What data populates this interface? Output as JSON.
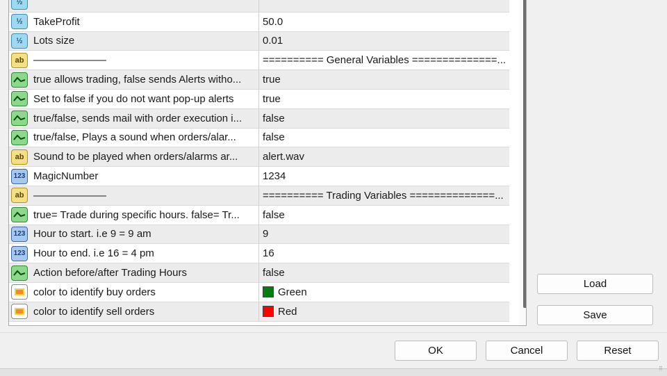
{
  "rows": [
    {
      "icon": "half-icon",
      "icon_text": "½",
      "name": "",
      "value": "",
      "alt": true
    },
    {
      "icon": "half-icon",
      "icon_text": "½",
      "name": "TakeProfit",
      "value": "50.0",
      "alt": false
    },
    {
      "icon": "half-icon",
      "icon_text": "½",
      "name": "Lots size",
      "value": "0.01",
      "alt": true
    },
    {
      "icon": "ab-icon",
      "icon_text": "ab",
      "name": "———————",
      "value": "========== General Variables ==============...",
      "alt": false
    },
    {
      "icon": "bool-icon",
      "icon_text": "",
      "name": "true allows trading, false sends Alerts witho...",
      "value": "true",
      "alt": true
    },
    {
      "icon": "bool-icon",
      "icon_text": "",
      "name": "Set to false if you do not want pop-up alerts",
      "value": "true",
      "alt": false
    },
    {
      "icon": "bool-icon",
      "icon_text": "",
      "name": "true/false, sends mail with order execution i...",
      "value": "false",
      "alt": true
    },
    {
      "icon": "bool-icon",
      "icon_text": "",
      "name": "true/false, Plays a sound when orders/alar...",
      "value": "false",
      "alt": false
    },
    {
      "icon": "ab-icon",
      "icon_text": "ab",
      "name": "Sound to be played when orders/alarms ar...",
      "value": "alert.wav",
      "alt": true
    },
    {
      "icon": "int-icon",
      "icon_text": "123",
      "name": "MagicNumber",
      "value": "1234",
      "alt": false
    },
    {
      "icon": "ab-icon",
      "icon_text": "ab",
      "name": "———————",
      "value": "========== Trading Variables ==============...",
      "alt": true
    },
    {
      "icon": "bool-icon",
      "icon_text": "",
      "name": "true= Trade during specific hours. false= Tr...",
      "value": "false",
      "alt": false
    },
    {
      "icon": "int-icon",
      "icon_text": "123",
      "name": "Hour to start. i.e 9 = 9 am",
      "value": "9",
      "alt": true
    },
    {
      "icon": "int-icon",
      "icon_text": "123",
      "name": "Hour to end. i.e 16 = 4 pm",
      "value": "16",
      "alt": false
    },
    {
      "icon": "bool-icon",
      "icon_text": "",
      "name": "Action before/after Trading Hours",
      "value": "false",
      "alt": true
    },
    {
      "icon": "color-icon",
      "icon_text": "",
      "name": "color to identify buy orders",
      "value": "Green",
      "swatch": "#007f0e",
      "alt": false
    },
    {
      "icon": "color-icon",
      "icon_text": "",
      "name": "color to identify sell orders",
      "value": "Red",
      "swatch": "#ff0000",
      "alt": true
    }
  ],
  "buttons": {
    "load": "Load",
    "save": "Save",
    "ok": "OK",
    "cancel": "Cancel",
    "reset": "Reset"
  }
}
